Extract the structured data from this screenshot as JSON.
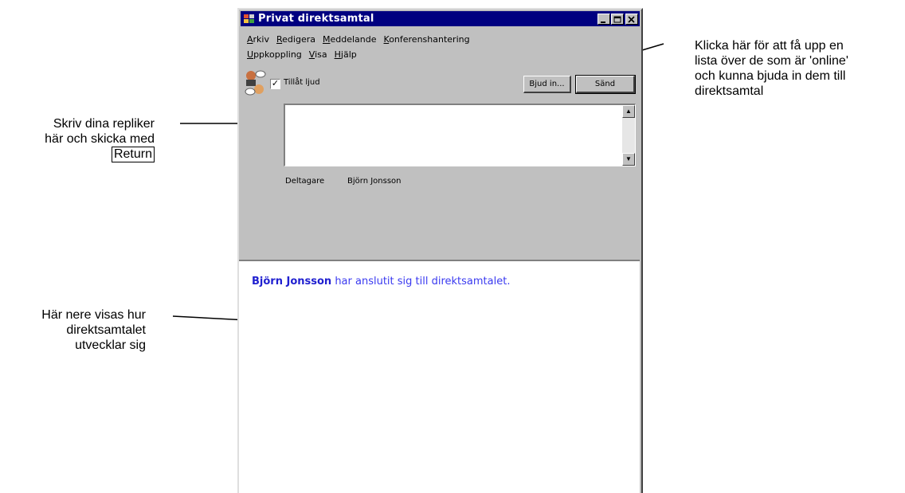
{
  "window": {
    "title": "Privat direktsamtal",
    "menu": [
      "Arkiv",
      "Redigera",
      "Meddelande",
      "Konferenshantering",
      "Uppkoppling",
      "Visa",
      "Hjälp"
    ],
    "checkbox_label": "Tillåt ljud",
    "checkbox_checked": true,
    "invite_button": "Bjud in...",
    "send_button": "Sänd",
    "input_value": "",
    "participants_label": "Deltagare",
    "participants_value": "Björn Jonsson",
    "chat": {
      "name": "Björn Jonsson",
      "text": " har anslutit sig till direktsamtalet."
    }
  },
  "annotations": {
    "left_top_lines": [
      "Skriv dina repliker",
      "här och skicka med"
    ],
    "left_top_boxed": "Return",
    "left_bottom_lines": [
      "Här nere visas hur",
      "direktsamtalet",
      "utvecklar sig"
    ],
    "right_lines": [
      "Klicka här för att få upp en",
      "lista över de som är 'online'",
      "och kunna bjuda in dem till",
      "direktsamtal"
    ]
  },
  "colors": {
    "titlebar": "#000080",
    "window_face": "#c0c0c0",
    "chat_text": "#3a3af0"
  }
}
